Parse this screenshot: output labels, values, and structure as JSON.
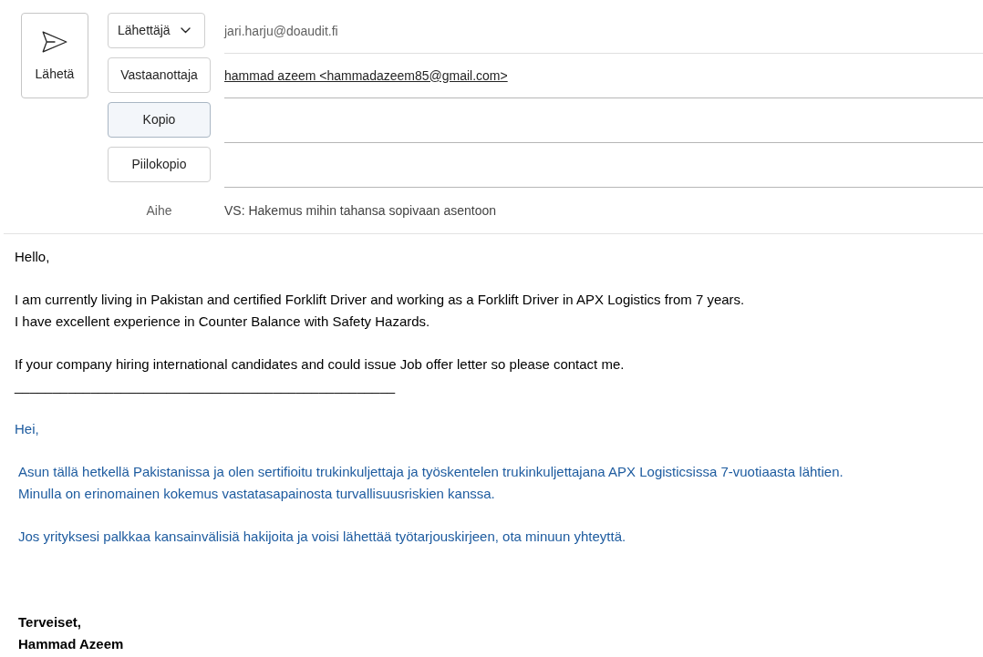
{
  "send_button": {
    "label": "Lähetä"
  },
  "header_fields": [
    {
      "kind": "dropdown",
      "label": "Lähettäjä",
      "hovered": false,
      "value": "jari.harju@doaudit.fi"
    },
    {
      "kind": "button",
      "label": "Vastaanottaja",
      "hovered": false,
      "recipients": [
        "hammad azeem <hammadazeem85@gmail.com>"
      ]
    },
    {
      "kind": "button",
      "label": "Kopio",
      "hovered": true
    },
    {
      "kind": "button",
      "label": "Piilokopio",
      "hovered": false
    }
  ],
  "subject": {
    "label": "Aihe",
    "value": "VS: Hakemus mihin tahansa sopivaan asentoon"
  },
  "body": [
    {
      "kind": "original",
      "indented": false,
      "lines": [
        "Hello,"
      ]
    },
    {
      "kind": "original",
      "indented": false,
      "lines": [
        "I am currently living in Pakistan and certified Forklift Driver and working as a Forklift Driver in APX Logistics from 7 years.",
        "I have excellent experience in Counter Balance with Safety Hazards."
      ]
    },
    {
      "kind": "original",
      "indented": false,
      "lines": [
        "If your company hiring international candidates and could issue Job offer letter so please contact me."
      ]
    },
    {
      "kind": "separator",
      "indented": false,
      "lines": [
        "__________________________________________________"
      ]
    },
    {
      "kind": "translation",
      "indented": false,
      "lines": [
        "Hei,"
      ]
    },
    {
      "kind": "translation",
      "indented": true,
      "lines": [
        "Asun tällä hetkellä Pakistanissa ja olen sertifioitu trukinkuljettaja ja työskentelen trukinkuljettajana APX Logisticsissa 7-vuotiaasta lähtien.",
        "Minulla on erinomainen kokemus vastatasapainosta turvallisuusriskien kanssa."
      ]
    },
    {
      "kind": "translation",
      "indented": true,
      "lines": [
        "Jos yrityksesi palkkaa kansainvälisiä hakijoita ja voisi lähettää työtarjouskirjeen, ota minuun yhteyttä."
      ]
    },
    {
      "kind": "signature",
      "indented": true,
      "lines": [
        "Terveiset,",
        "Hammad Azeem"
      ]
    }
  ]
}
